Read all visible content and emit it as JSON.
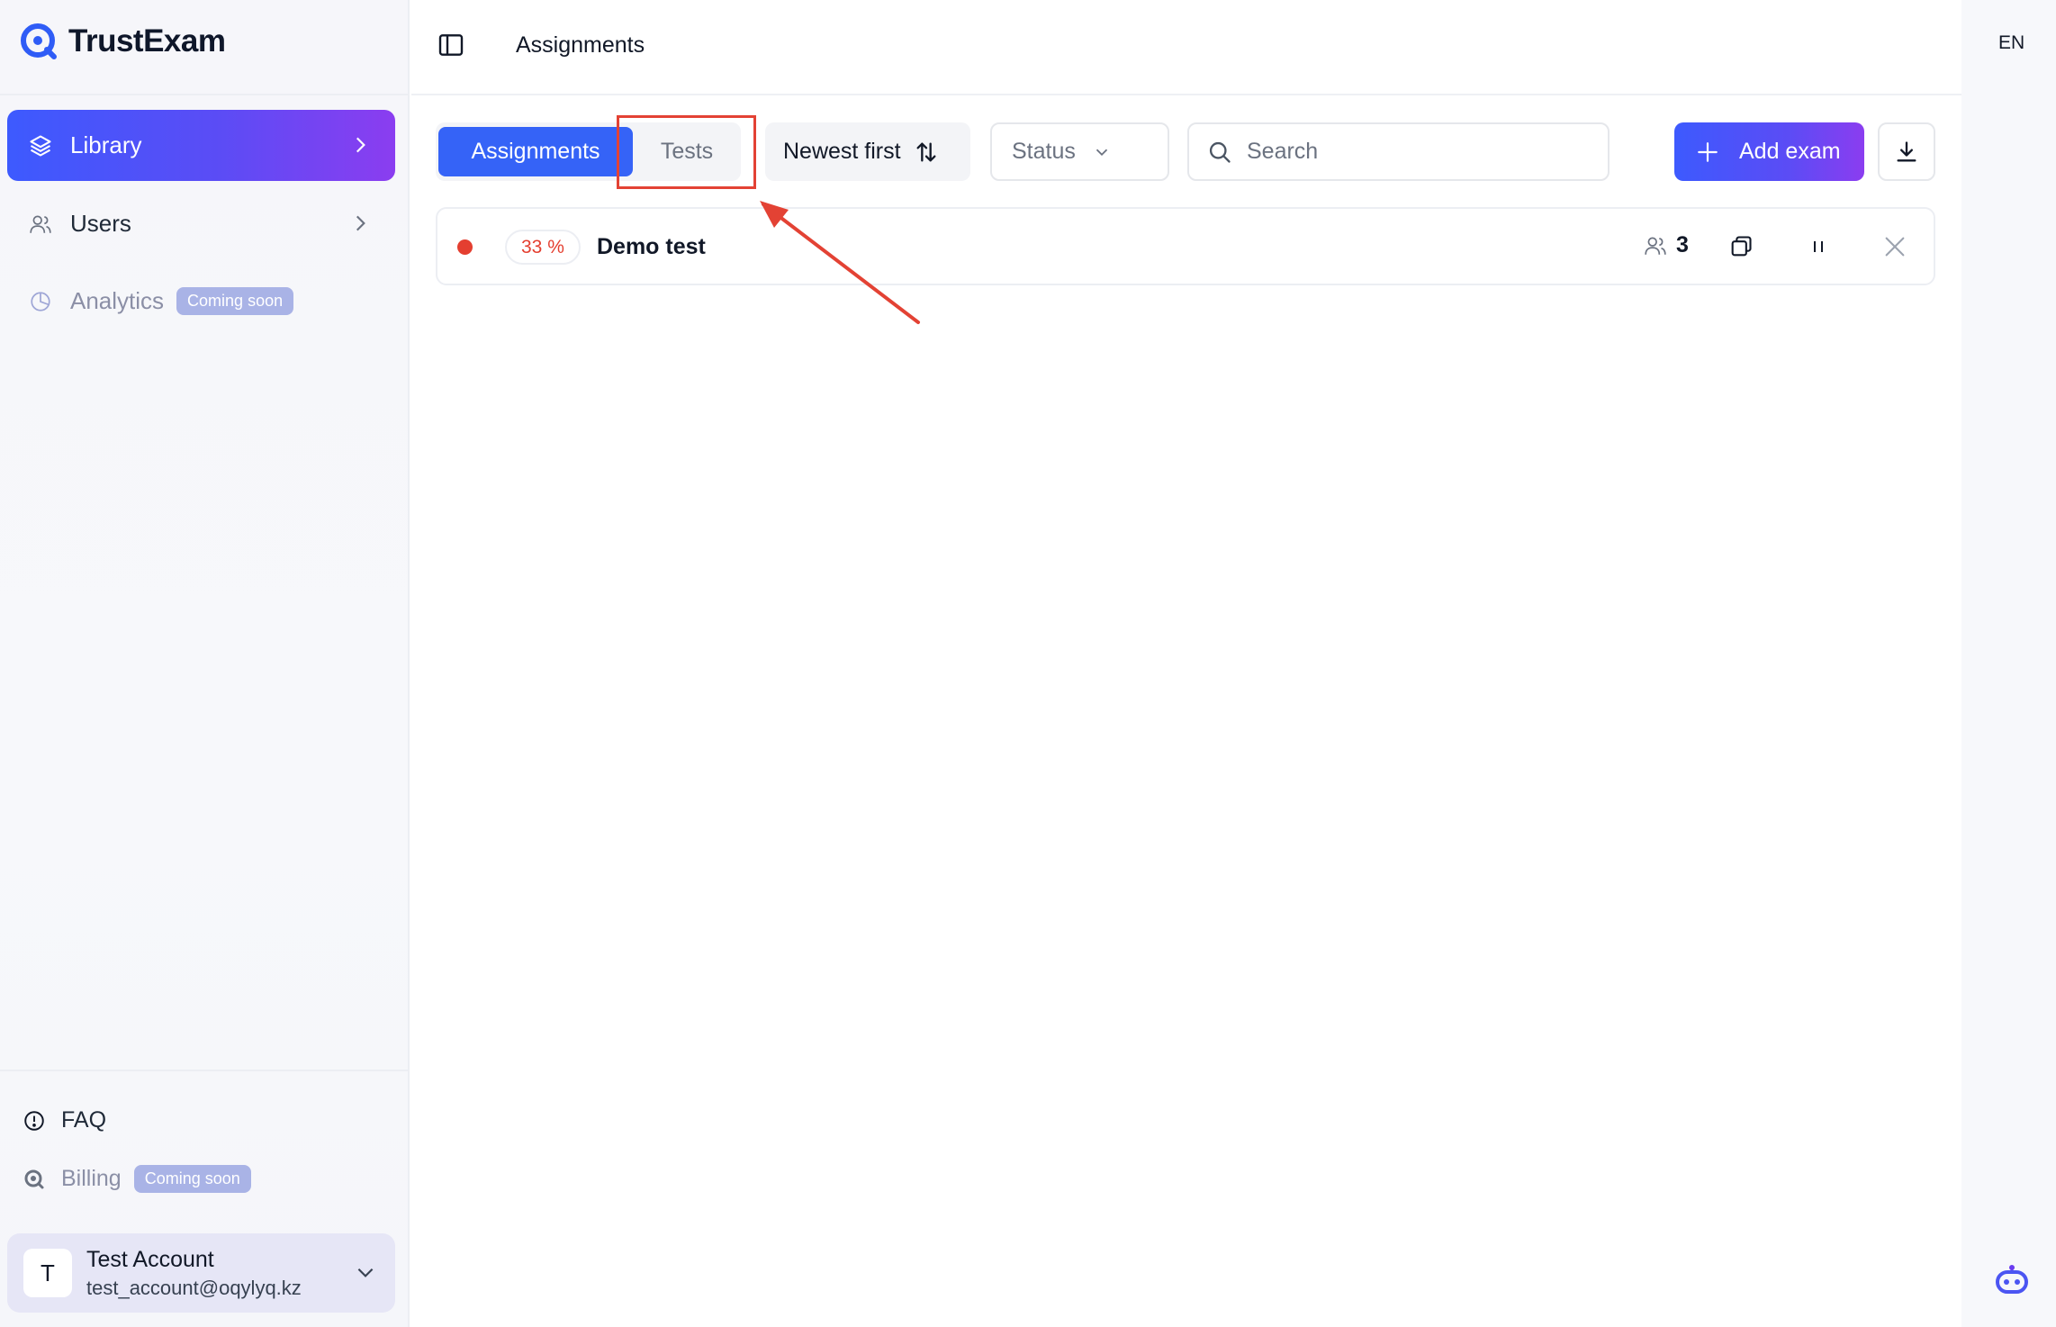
{
  "app": {
    "name": "TrustExam",
    "brand_color": "#3563f7",
    "accent_gradient": [
      "#3d5afe",
      "#8b3df0"
    ]
  },
  "sidebar": {
    "items": [
      {
        "label": "Library",
        "icon": "layers-icon",
        "active": true
      },
      {
        "label": "Users",
        "icon": "users-icon"
      },
      {
        "label": "Analytics",
        "icon": "pie-chart-icon",
        "badge": "Coming soon"
      }
    ],
    "footer": [
      {
        "label": "FAQ",
        "icon": "info-circle-icon"
      },
      {
        "label": "Billing",
        "icon": "billing-icon",
        "badge": "Coming soon"
      }
    ],
    "account": {
      "initial": "T",
      "name": "Test Account",
      "email": "test_account@oqylyq.kz"
    }
  },
  "header": {
    "title": "Assignments",
    "language": "EN"
  },
  "toolbar": {
    "tabs": [
      {
        "label": "Assignments",
        "active": true
      },
      {
        "label": "Tests",
        "active": false
      }
    ],
    "sort_label": "Newest first",
    "status_label": "Status",
    "search_placeholder": "Search",
    "search_value": "",
    "add_label": "Add exam"
  },
  "exams": [
    {
      "status_color": "#e43f30",
      "percent": "33 %",
      "title": "Demo test",
      "participants": "3"
    }
  ],
  "annotation": {
    "highlight_color": "#e34234",
    "target": "Tests tab"
  }
}
